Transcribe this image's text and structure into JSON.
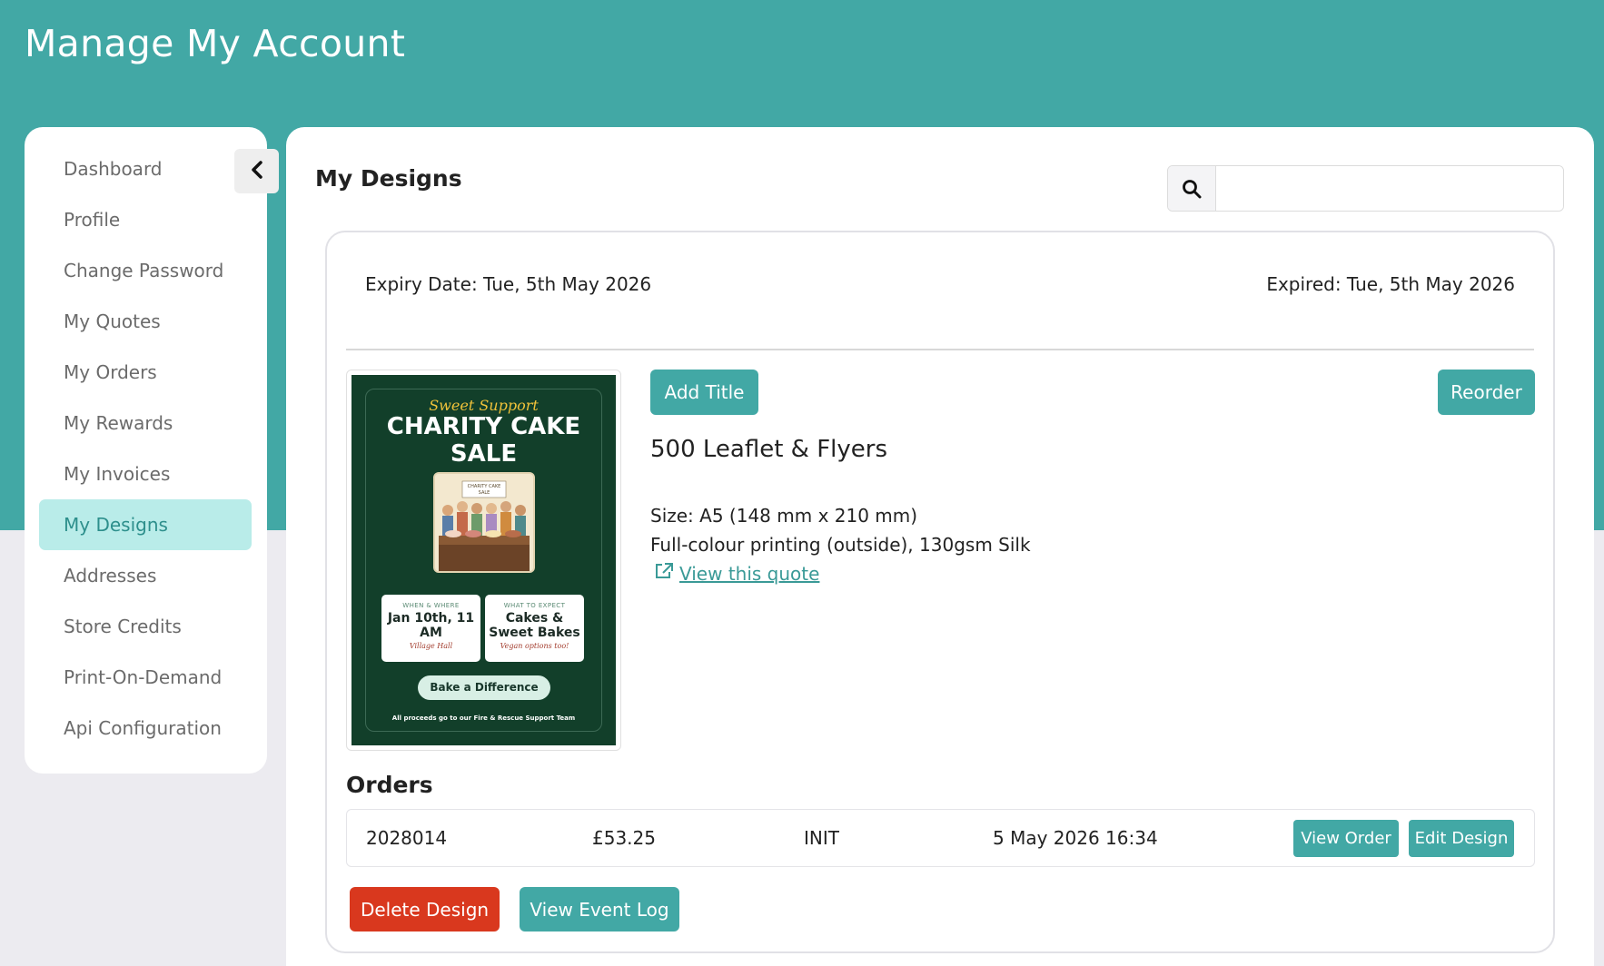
{
  "header": {
    "title": "Manage My Account"
  },
  "sidebar": {
    "collapse_icon": "chevron-left-icon",
    "items": [
      {
        "label": "Dashboard",
        "active": false
      },
      {
        "label": "Profile",
        "active": false
      },
      {
        "label": "Change Password",
        "active": false
      },
      {
        "label": "My Quotes",
        "active": false
      },
      {
        "label": "My Orders",
        "active": false
      },
      {
        "label": "My Rewards",
        "active": false
      },
      {
        "label": "My Invoices",
        "active": false
      },
      {
        "label": "My Designs",
        "active": true
      },
      {
        "label": "Addresses",
        "active": false
      },
      {
        "label": "Store Credits",
        "active": false
      },
      {
        "label": "Print-On-Demand",
        "active": false
      },
      {
        "label": "Api Configuration",
        "active": false
      }
    ]
  },
  "main": {
    "title": "My Designs",
    "search": {
      "icon": "search-icon",
      "value": "",
      "placeholder": ""
    }
  },
  "design": {
    "expiry_date": "Expiry Date: Tue, 5th May 2026",
    "expired": "Expired: Tue, 5th May 2026",
    "add_title_label": "Add Title",
    "reorder_label": "Reorder",
    "product_name": "500 Leaflet & Flyers",
    "size": "Size: A5 (148 mm x 210 mm)",
    "printing": "Full-colour printing (outside), 130gsm Silk",
    "quote_link": "View this quote",
    "thumbnail": {
      "script": "Sweet Support",
      "headline_1": "CHARITY CAKE",
      "headline_2": "SALE",
      "illustration_banner": "CHARITY CAKE SALE",
      "box_left_small": "WHEN & WHERE",
      "box_left_big": "Jan 10th, 11 AM",
      "box_left_script": "Village Hall",
      "box_right_small": "WHAT TO EXPECT",
      "box_right_big": "Cakes & Sweet Bakes",
      "box_right_script": "Vegan options too!",
      "pill": "Bake a Difference",
      "footer": "All proceeds go to our Fire & Rescue Support Team"
    }
  },
  "orders": {
    "title": "Orders",
    "rows": [
      {
        "id": "2028014",
        "amount": "£53.25",
        "status": "INIT",
        "date": "5 May 2026 16:34"
      }
    ],
    "view_order_label": "View Order",
    "edit_design_label": "Edit Design"
  },
  "actions": {
    "delete_label": "Delete Design",
    "event_log_label": "View Event Log"
  },
  "colors": {
    "brand": "#42a8a5",
    "active_nav_bg": "#b9ece9",
    "danger": "#d9381e"
  }
}
